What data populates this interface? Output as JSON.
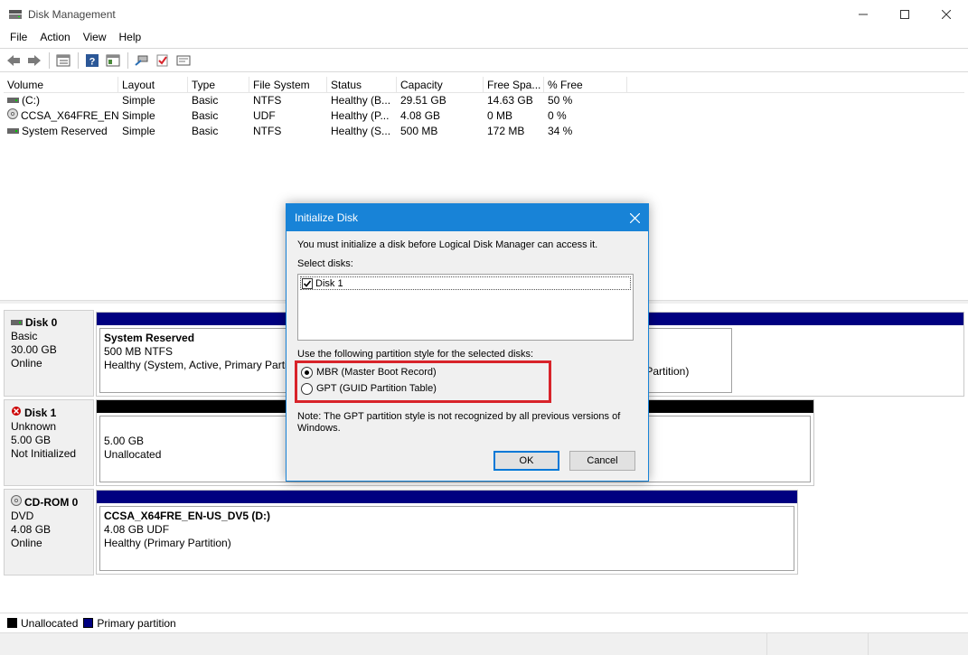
{
  "window": {
    "title": "Disk Management",
    "icon": "disk-management-icon"
  },
  "menu": [
    "File",
    "Action",
    "View",
    "Help"
  ],
  "toolbar": {
    "icons": [
      "back-arrow-icon",
      "forward-arrow-icon",
      "properties-list-icon",
      "help-icon",
      "console-tree-icon",
      "connect-icon",
      "check-icon",
      "settings-icon"
    ]
  },
  "volumes": {
    "headers": [
      "Volume",
      "Layout",
      "Type",
      "File System",
      "Status",
      "Capacity",
      "Free Spa...",
      "% Free"
    ],
    "rows": [
      {
        "volume": "(C:)",
        "layout": "Simple",
        "type": "Basic",
        "fs": "NTFS",
        "status": "Healthy (B...",
        "capacity": "29.51 GB",
        "free": "14.63 GB",
        "pct": "50 %",
        "icon": "drive-icon"
      },
      {
        "volume": "CCSA_X64FRE_EN-...",
        "layout": "Simple",
        "type": "Basic",
        "fs": "UDF",
        "status": "Healthy (P...",
        "capacity": "4.08 GB",
        "free": "0 MB",
        "pct": "0 %",
        "icon": "cd-icon"
      },
      {
        "volume": "System Reserved",
        "layout": "Simple",
        "type": "Basic",
        "fs": "NTFS",
        "status": "Healthy (S...",
        "capacity": "500 MB",
        "free": "172 MB",
        "pct": "34 %",
        "icon": "drive-icon"
      }
    ]
  },
  "disks": [
    {
      "name": "Disk 0",
      "type": "Basic",
      "size": "30.00 GB",
      "state": "Online",
      "partition": {
        "name": "System Reserved",
        "detail": "500 MB NTFS",
        "status": "Healthy (System, Active, Primary Partiti",
        "status_tail": "y Partition)"
      }
    },
    {
      "name": "Disk 1",
      "type": "Unknown",
      "size": "5.00 GB",
      "state": "Not Initialized",
      "partition": {
        "name": "",
        "detail": "5.00 GB",
        "status": "Unallocated"
      }
    },
    {
      "name": "CD-ROM 0",
      "type": "DVD",
      "size": "4.08 GB",
      "state": "Online",
      "partition": {
        "name": "CCSA_X64FRE_EN-US_DV5  (D:)",
        "detail": "4.08 GB UDF",
        "status": "Healthy (Primary Partition)"
      }
    }
  ],
  "legend": [
    {
      "label": "Unallocated",
      "color": "#000000"
    },
    {
      "label": "Primary partition",
      "color": "#000080"
    }
  ],
  "dialog": {
    "title": "Initialize Disk",
    "intro": "You must initialize a disk before Logical Disk Manager can access it.",
    "select_label": "Select disks:",
    "disk_item": "Disk 1",
    "disk_checked": true,
    "style_label": "Use the following partition style for the selected disks:",
    "mbr_label": "MBR (Master Boot Record)",
    "gpt_label": "GPT (GUID Partition Table)",
    "selected": "MBR",
    "note_line1": "Note: The GPT partition style is not recognized by all previous versions of",
    "note_line2": "Windows.",
    "ok_label": "OK",
    "cancel_label": "Cancel"
  },
  "colors": {
    "primary": "#000080",
    "unallocated": "#000000",
    "dialog_accent": "#1883d7",
    "highlight": "#d8232a"
  }
}
